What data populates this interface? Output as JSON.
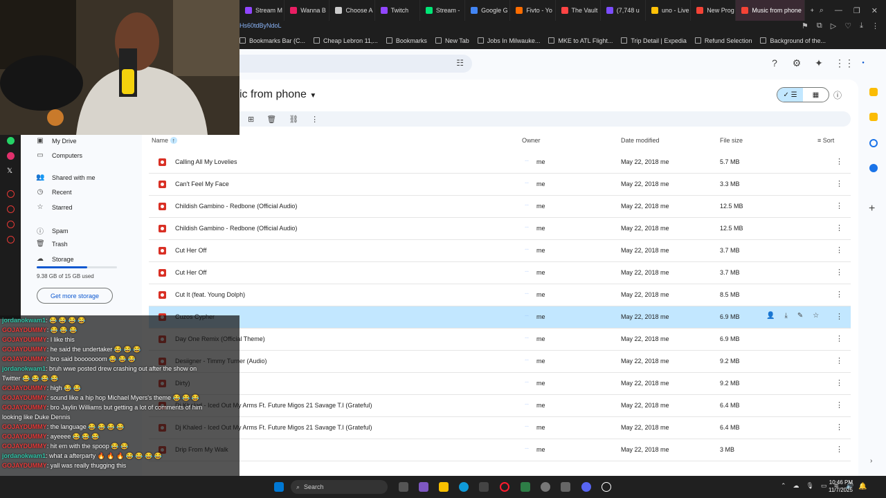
{
  "browser": {
    "tabs": [
      {
        "label": "Stream M",
        "color": "#9146ff"
      },
      {
        "label": "Wanna B",
        "color": "#e91e63"
      },
      {
        "label": "Choose A",
        "color": "#cccccc"
      },
      {
        "label": "Twitch",
        "color": "#9146ff"
      },
      {
        "label": "Stream -",
        "color": "#00e676"
      },
      {
        "label": "Google G",
        "color": "#4285f4"
      },
      {
        "label": "Fivto - Yo",
        "color": "#ff6d00"
      },
      {
        "label": "The Vault",
        "color": "#ff4444"
      },
      {
        "label": "(7,748 u",
        "color": "#7c4dff"
      },
      {
        "label": "uno - Live",
        "color": "#ffc107"
      },
      {
        "label": "New Prog",
        "color": "#f44336"
      },
      {
        "label": "Music from phone",
        "color": "#f44336",
        "active": true
      }
    ],
    "url": "Hs60tdByNdoL",
    "bookmarks": [
      "Bookmarks Bar (C...",
      "Cheap Lebron 11,...",
      "Bookmarks",
      "New Tab",
      "Jobs In Milwauke...",
      "MKE to ATL Flight...",
      "Trip Detail | Expedia",
      "Refund Selection",
      "Background of the..."
    ]
  },
  "drive": {
    "folder_title": "ic from phone",
    "columns": {
      "name": "Name",
      "owner": "Owner",
      "date": "Date modified",
      "size": "File size",
      "sort": "Sort"
    },
    "sidebar": [
      {
        "label": "My Drive",
        "icon": "drive-icon"
      },
      {
        "label": "Computers",
        "icon": "computer-icon"
      },
      {
        "label": "Shared with me",
        "icon": "people-icon"
      },
      {
        "label": "Recent",
        "icon": "clock-icon"
      },
      {
        "label": "Starred",
        "icon": "star-icon"
      },
      {
        "label": "Spam",
        "icon": "spam-icon"
      },
      {
        "label": "Trash",
        "icon": "trash-icon"
      },
      {
        "label": "Storage",
        "icon": "cloud-icon"
      }
    ],
    "storage_used_fraction": 0.625,
    "storage_text": "9.38 GB of 15 GB used",
    "get_storage": "Get more storage",
    "files": [
      {
        "name": "Calling All My Lovelies",
        "owner": "me",
        "date": "May 22, 2018 me",
        "size": "5.7 MB"
      },
      {
        "name": "Can't Feel My Face",
        "owner": "me",
        "date": "May 22, 2018 me",
        "size": "3.3 MB"
      },
      {
        "name": "Childish Gambino - Redbone (Official Audio)",
        "owner": "me",
        "date": "May 22, 2018 me",
        "size": "12.5 MB"
      },
      {
        "name": "Childish Gambino - Redbone (Official Audio)",
        "owner": "me",
        "date": "May 22, 2018 me",
        "size": "12.5 MB"
      },
      {
        "name": "Cut Her Off",
        "owner": "me",
        "date": "May 22, 2018 me",
        "size": "3.7 MB"
      },
      {
        "name": "Cut Her Off",
        "owner": "me",
        "date": "May 22, 2018 me",
        "size": "3.7 MB"
      },
      {
        "name": "Cut It (feat. Young Dolph)",
        "owner": "me",
        "date": "May 22, 2018 me",
        "size": "8.5 MB"
      },
      {
        "name": "Cuzos Cypher",
        "owner": "me",
        "date": "May 22, 2018 me",
        "size": "6.9 MB",
        "selected": true
      },
      {
        "name": "Day One Remix (Official Theme)",
        "owner": "me",
        "date": "May 22, 2018 me",
        "size": "6.9 MB"
      },
      {
        "name": "Desiigner - Timmy Turner (Audio)",
        "owner": "me",
        "date": "May 22, 2018 me",
        "size": "9.2 MB"
      },
      {
        "name": "Dirty)",
        "owner": "me",
        "date": "May 22, 2018 me",
        "size": "9.2 MB"
      },
      {
        "name": "Dj Khaled - Iced Out My Arms Ft. Future Migos 21 Savage  T.I (Grateful)",
        "owner": "me",
        "date": "May 22, 2018 me",
        "size": "6.4 MB"
      },
      {
        "name": "Dj Khaled - Iced Out My Arms Ft. Future Migos 21 Savage  T.I (Grateful)",
        "owner": "me",
        "date": "May 22, 2018 me",
        "size": "6.4 MB"
      },
      {
        "name": "Drip From My Walk",
        "owner": "me",
        "date": "May 22, 2018 me",
        "size": "3 MB"
      }
    ]
  },
  "chat": [
    {
      "user": "jordanokwam1",
      "color": "teal",
      "msg": ": 😂 😂 😂 😂"
    },
    {
      "user": "GOJAYDUMMY",
      "color": "red",
      "msg": ": 😂 😂 😂"
    },
    {
      "user": "GOJAYDUMMY",
      "color": "red",
      "msg": ": I like this"
    },
    {
      "user": "GOJAYDUMMY",
      "color": "red",
      "msg": ": he said the undertaker 😂 😂 😂"
    },
    {
      "user": "GOJAYDUMMY",
      "color": "red",
      "msg": ": bro said booooooom 😂 😂 😂"
    },
    {
      "user": "jordanokwam1",
      "color": "teal",
      "msg": ": bruh wwe posted drew crashing out after the show on"
    },
    {
      "user": "",
      "color": "white",
      "msg": "Twitter 😂 😂 😂 😂"
    },
    {
      "user": "GOJAYDUMMY",
      "color": "red",
      "msg": ": high 😂 😂"
    },
    {
      "user": "GOJAYDUMMY",
      "color": "red",
      "msg": ": sound like a hip hop Michael Myers's theme 😂 😂 😂"
    },
    {
      "user": "GOJAYDUMMY",
      "color": "red",
      "msg": ": bro Jaylin Williams but getting a lot of comments of him"
    },
    {
      "user": "",
      "color": "white",
      "msg": "looking like Duke Dennis"
    },
    {
      "user": "GOJAYDUMMY",
      "color": "red",
      "msg": ": the language 😂 😂 😂 😂"
    },
    {
      "user": "GOJAYDUMMY",
      "color": "red",
      "msg": ": ayeeee 😂 😂 😂"
    },
    {
      "user": "GOJAYDUMMY",
      "color": "red",
      "msg": ": hit em with the spoop 😂 😂"
    },
    {
      "user": "jordanokwam1",
      "color": "teal",
      "msg": ": what a afterparty 🔥 🔥 🔥 😂 😂 😂 😂"
    },
    {
      "user": "GOJAYDUMMY",
      "color": "red",
      "msg": ": yall was really thugging this"
    }
  ],
  "taskbar": {
    "search": "Search",
    "time": "10:46 PM",
    "date": "11/7/2025"
  }
}
